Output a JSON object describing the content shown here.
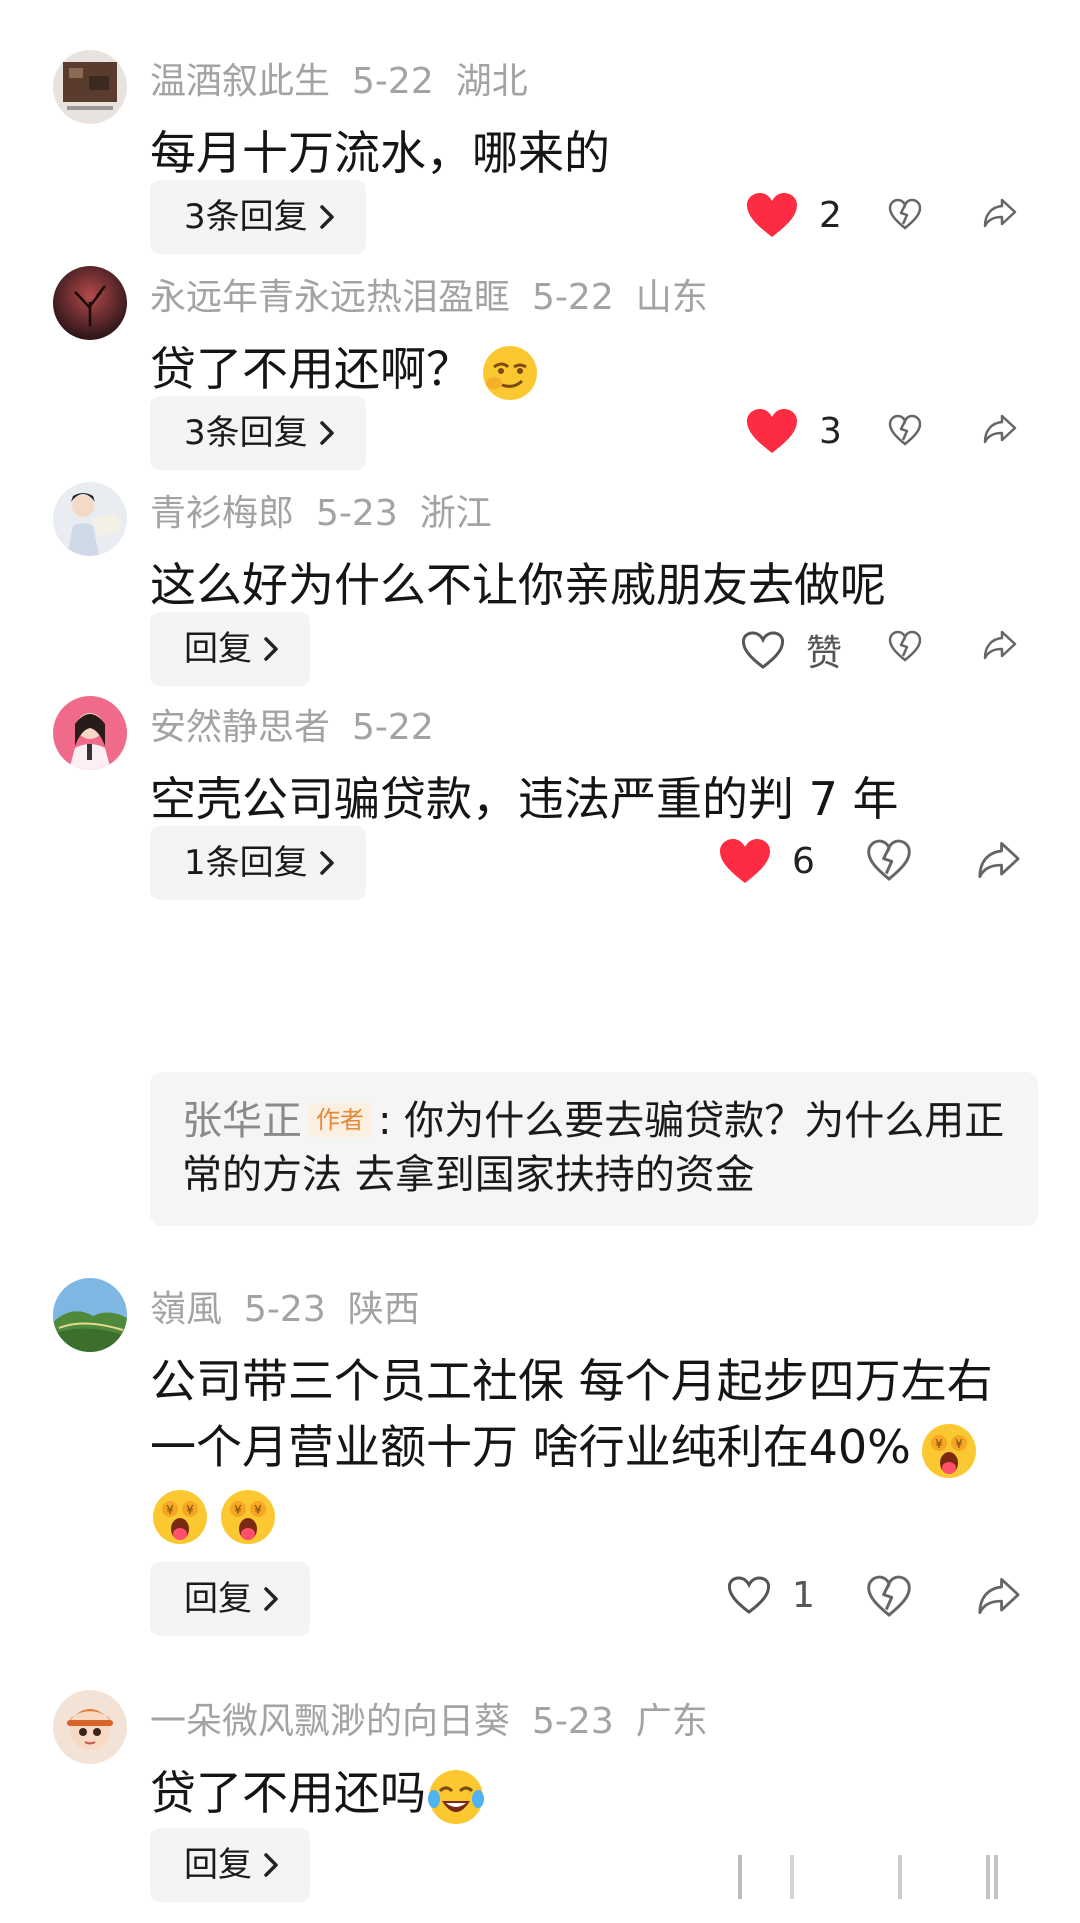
{
  "comments": [
    {
      "username": "温酒叙此生",
      "date": "5-22",
      "location": "湖北",
      "text": "每月十万流水，哪来的",
      "reply_label": "3条回复",
      "likes": "2",
      "liked": true
    },
    {
      "username": "永远年青永远热泪盈眶",
      "date": "5-22",
      "location": "山东",
      "text": "贷了不用还啊？",
      "emoji": "smirk-face-emoji",
      "reply_label": "3条回复",
      "likes": "3",
      "liked": true
    },
    {
      "username": "青衫梅郎",
      "date": "5-23",
      "location": "浙江",
      "text": "这么好为什么不让你亲戚朋友去做呢",
      "reply_label": "回复",
      "likes": "赞",
      "liked": false
    },
    {
      "username": "安然静思者",
      "date": "5-22",
      "text": "空壳公司骗贷款，违法严重的判 7 年",
      "reply_label": "1条回复",
      "likes": "6",
      "liked": true,
      "author_reply": {
        "name": "张华正",
        "tag": "作者",
        "text": ": 你为什么要去骗贷款？为什么用正常的方法 去拿到国家扶持的资金"
      }
    },
    {
      "username": "嶺風",
      "date": "5-23",
      "location": "陕西",
      "text_line1": "公司带三个员工社保 每个月起步四万左右",
      "text_line2": "一个月营业额十万 啥行业纯利在40%",
      "emoji": "money-face-emoji",
      "reply_label": "回复",
      "likes": "1",
      "liked": false
    },
    {
      "username": "一朵微风飘渺的向日葵",
      "date": "5-23",
      "location": "广东",
      "text": "贷了不用还吗",
      "emoji": "laughing-tears-emoji",
      "reply_label": "回复"
    }
  ],
  "colors": {
    "liked_heart": "#fe2c43",
    "meta_gray": "#a3a3a3",
    "author_tag": "#e08a3a"
  }
}
